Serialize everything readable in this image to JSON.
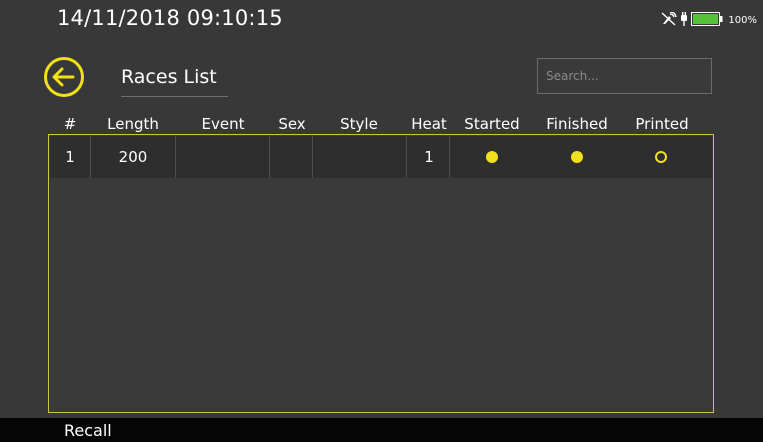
{
  "status": {
    "datetime": "14/11/2018  09:10:15",
    "battery_percent": "100%",
    "icons": [
      "gps-off-icon",
      "plug-icon",
      "battery-icon"
    ]
  },
  "page": {
    "back_icon": "arrow-left-circle-icon",
    "title": "Races List",
    "search_placeholder": "Search..."
  },
  "table": {
    "headers": [
      "#",
      "Length",
      "Event",
      "Sex",
      "Style",
      "Heat",
      "Started",
      "Finished",
      "Printed"
    ],
    "rows": [
      {
        "num": "1",
        "length": "200",
        "event": "",
        "sex": "",
        "style": "",
        "heat": "1",
        "started": true,
        "finished": true,
        "printed": false
      }
    ]
  },
  "footer": {
    "label": "Recall"
  },
  "colors": {
    "accent": "#f0e11c",
    "background": "#383838",
    "footer": "#050505"
  }
}
